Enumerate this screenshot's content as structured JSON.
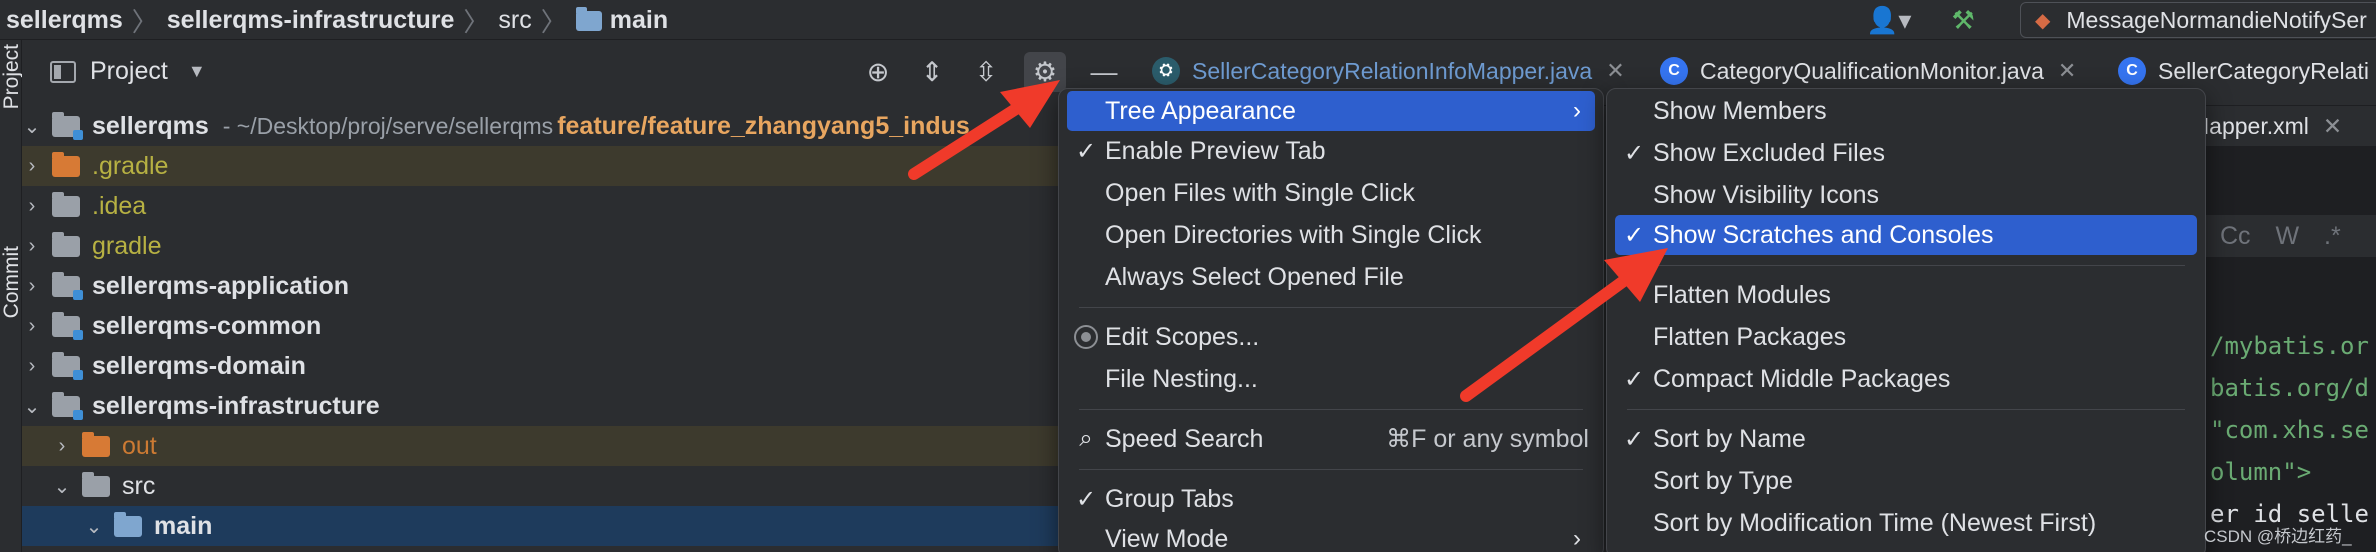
{
  "breadcrumb": {
    "items": [
      "sellerqms",
      "sellerqms-infrastructure",
      "src",
      "main"
    ]
  },
  "run_config": {
    "label": "MessageNormandieNotifySer"
  },
  "side_tabs": {
    "project": "Project",
    "commit": "Commit"
  },
  "project_panel": {
    "title": "Project",
    "icons": [
      "locate-icon",
      "expand-all-icon",
      "collapse-all-icon",
      "gear-icon",
      "minimize-icon"
    ]
  },
  "tree": {
    "root": {
      "name": "sellerqms",
      "path": "- ~/Desktop/proj/serve/sellerqms",
      "branch": "feature/feature_zhangyang5_indus"
    },
    "items": [
      {
        "name": ".gradle",
        "style": "olive"
      },
      {
        "name": ".idea",
        "style": "olive"
      },
      {
        "name": "gradle",
        "style": "olive"
      },
      {
        "name": "sellerqms-application",
        "style": "bold"
      },
      {
        "name": "sellerqms-common",
        "style": "bold"
      },
      {
        "name": "sellerqms-domain",
        "style": "bold"
      },
      {
        "name": "sellerqms-infrastructure",
        "style": "bold"
      },
      {
        "name": "out",
        "style": "orange"
      },
      {
        "name": "src",
        "style": "plain"
      },
      {
        "name": "main",
        "style": "bold"
      }
    ]
  },
  "editor_tabs": [
    {
      "label": "SellerCategoryRelationInfoMapper.java"
    },
    {
      "label": "CategoryQualificationMonitor.java"
    },
    {
      "label": "SellerCategoryRelati"
    }
  ],
  "mapper_tab": {
    "label": "Mapper.xml"
  },
  "find_bar": {
    "options": "Cc W .*"
  },
  "code_lines": [
    "/mybatis.or",
    "batis.org/d",
    "\"com.xhs.se",
    "olumn\">",
    "er id selle"
  ],
  "menu_main": {
    "items": [
      {
        "label": "Tree Appearance",
        "check": "",
        "arrow": "›",
        "shortcut": ""
      },
      {
        "label": "Enable Preview Tab",
        "check": "✓",
        "arrow": "",
        "shortcut": ""
      },
      {
        "label": "Open Files with Single Click",
        "check": "",
        "arrow": "",
        "shortcut": ""
      },
      {
        "label": "Open Directories with Single Click",
        "check": "",
        "arrow": "",
        "shortcut": ""
      },
      {
        "label": "Always Select Opened File",
        "check": "",
        "arrow": "",
        "shortcut": ""
      },
      {
        "label": "Edit Scopes...",
        "check": "",
        "arrow": "",
        "shortcut": ""
      },
      {
        "label": "File Nesting...",
        "check": "",
        "arrow": "",
        "shortcut": ""
      },
      {
        "label": "Speed Search",
        "check": "",
        "arrow": "",
        "shortcut": "⌘F or any symbol"
      },
      {
        "label": "Group Tabs",
        "check": "✓",
        "arrow": "",
        "shortcut": ""
      },
      {
        "label": "View Mode",
        "check": "",
        "arrow": "›",
        "shortcut": ""
      }
    ]
  },
  "menu_tree": {
    "items": [
      {
        "label": "Show Members",
        "check": ""
      },
      {
        "label": "Show Excluded Files",
        "check": "✓"
      },
      {
        "label": "Show Visibility Icons",
        "check": ""
      },
      {
        "label": "Show Scratches and Consoles",
        "check": "✓"
      },
      {
        "label": "Flatten Modules",
        "check": ""
      },
      {
        "label": "Flatten Packages",
        "check": ""
      },
      {
        "label": "Compact Middle Packages",
        "check": "✓"
      },
      {
        "label": "Sort by Name",
        "check": "✓"
      },
      {
        "label": "Sort by Type",
        "check": ""
      },
      {
        "label": "Sort by Modification Time (Newest First)",
        "check": ""
      }
    ]
  },
  "watermark": "CSDN @桥边红药_",
  "colors": {
    "highlight": "#2e5fce",
    "arrow": "#f03a2a",
    "branch": "#e8a660"
  }
}
